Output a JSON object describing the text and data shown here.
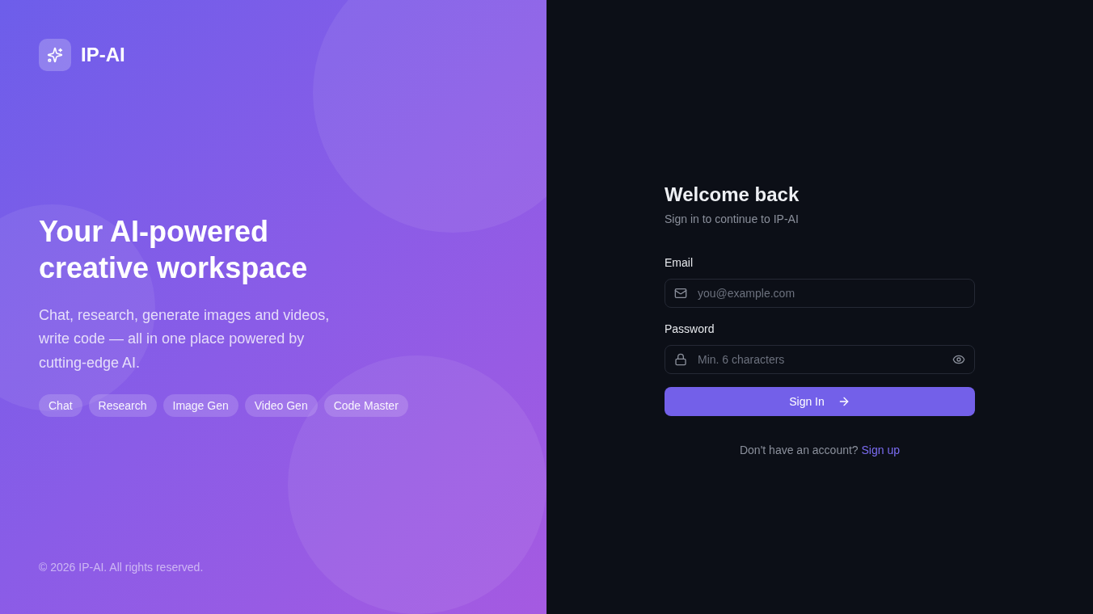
{
  "brand": {
    "name": "IP-AI"
  },
  "hero": {
    "headline": "Your AI-powered creative workspace",
    "description": "Chat, research, generate images and videos, write code — all in one place powered by cutting-edge AI.",
    "tags": [
      "Chat",
      "Research",
      "Image Gen",
      "Video Gen",
      "Code Master"
    ]
  },
  "footer": {
    "copyright": "© 2026 IP-AI. All rights reserved."
  },
  "login": {
    "title": "Welcome back",
    "subtitle": "Sign in to continue to IP-AI",
    "fields": [
      {
        "kind": "email",
        "label": "Email",
        "placeholder": "you@example.com"
      },
      {
        "kind": "password",
        "label": "Password",
        "placeholder": "Min. 6 characters"
      }
    ],
    "submit": {
      "label": "Sign In"
    },
    "signup": {
      "prompt": "Don't have an account?",
      "link": "Sign up"
    }
  }
}
